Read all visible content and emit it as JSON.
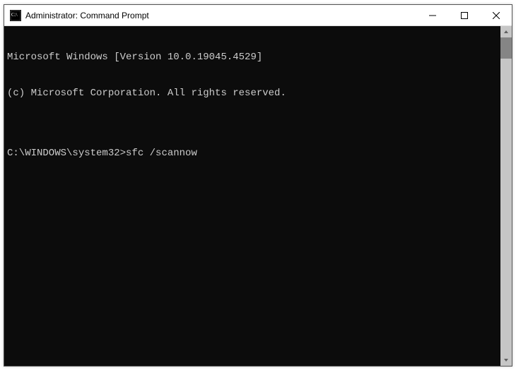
{
  "window": {
    "title": "Administrator: Command Prompt"
  },
  "terminal": {
    "lines": [
      "Microsoft Windows [Version 10.0.19045.4529]",
      "(c) Microsoft Corporation. All rights reserved.",
      "",
      ""
    ],
    "prompt": "C:\\WINDOWS\\system32>",
    "command": "sfc /scannow"
  }
}
